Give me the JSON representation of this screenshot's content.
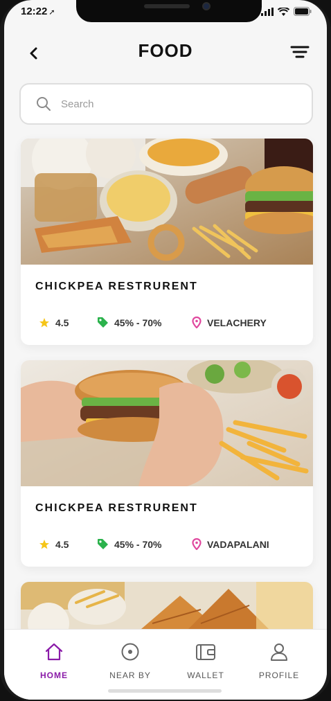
{
  "status": {
    "time": "12:22"
  },
  "header": {
    "title": "FOOD"
  },
  "search": {
    "placeholder": "Search"
  },
  "restaurants": [
    {
      "name": "CHICKPEA RESTRURENT",
      "rating": "4.5",
      "offer": "45% - 70%",
      "location": "VELACHERY"
    },
    {
      "name": "CHICKPEA RESTRURENT",
      "rating": "4.5",
      "offer": "45% - 70%",
      "location": "VADAPALANI"
    }
  ],
  "tabs": [
    {
      "label": "HOME",
      "icon": "home-icon",
      "active": true
    },
    {
      "label": "NEAR BY",
      "icon": "near-by-icon",
      "active": false
    },
    {
      "label": "WALLET",
      "icon": "wallet-icon",
      "active": false
    },
    {
      "label": "PROFILE",
      "icon": "profile-icon",
      "active": false
    }
  ],
  "colors": {
    "accent": "#8a1ba8",
    "star": "#f5c518",
    "tag": "#2bb24c",
    "pin": "#e0479e"
  }
}
